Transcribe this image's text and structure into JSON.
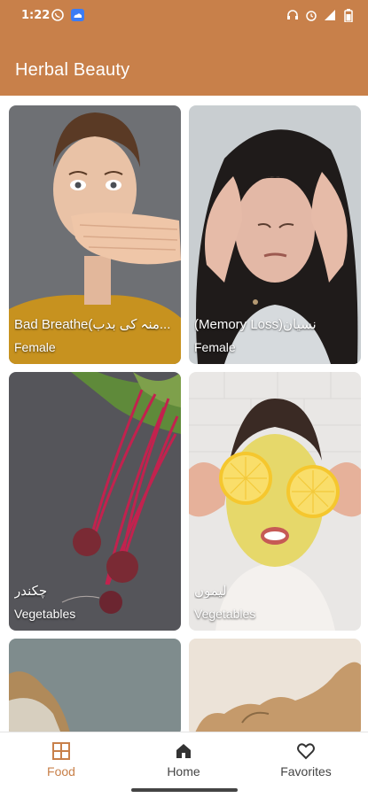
{
  "status_bar": {
    "time": "1:22",
    "icons_left": [
      "whatsapp-icon",
      "cloud-icon"
    ],
    "icons_right": [
      "headset-icon",
      "alarm-icon",
      "signal-icon",
      "battery-icon"
    ]
  },
  "app": {
    "title": "Herbal Beauty",
    "accent_color": "#c8804a"
  },
  "cards": [
    {
      "title": "Bad Breathe(منہ کی بدب...",
      "category": "Female"
    },
    {
      "title": "(Memory Loss)نسیان",
      "category": "Female"
    },
    {
      "title": "چکندر",
      "category": "Vegetables"
    },
    {
      "title": "لیموں",
      "category": "Vegetables"
    },
    {
      "title": "",
      "category": ""
    },
    {
      "title": "",
      "category": ""
    }
  ],
  "bottom_nav": {
    "items": [
      {
        "label": "Food",
        "icon": "grid-icon",
        "active": true
      },
      {
        "label": "Home",
        "icon": "home-icon",
        "active": false
      },
      {
        "label": "Favorites",
        "icon": "heart-icon",
        "active": false
      }
    ]
  }
}
